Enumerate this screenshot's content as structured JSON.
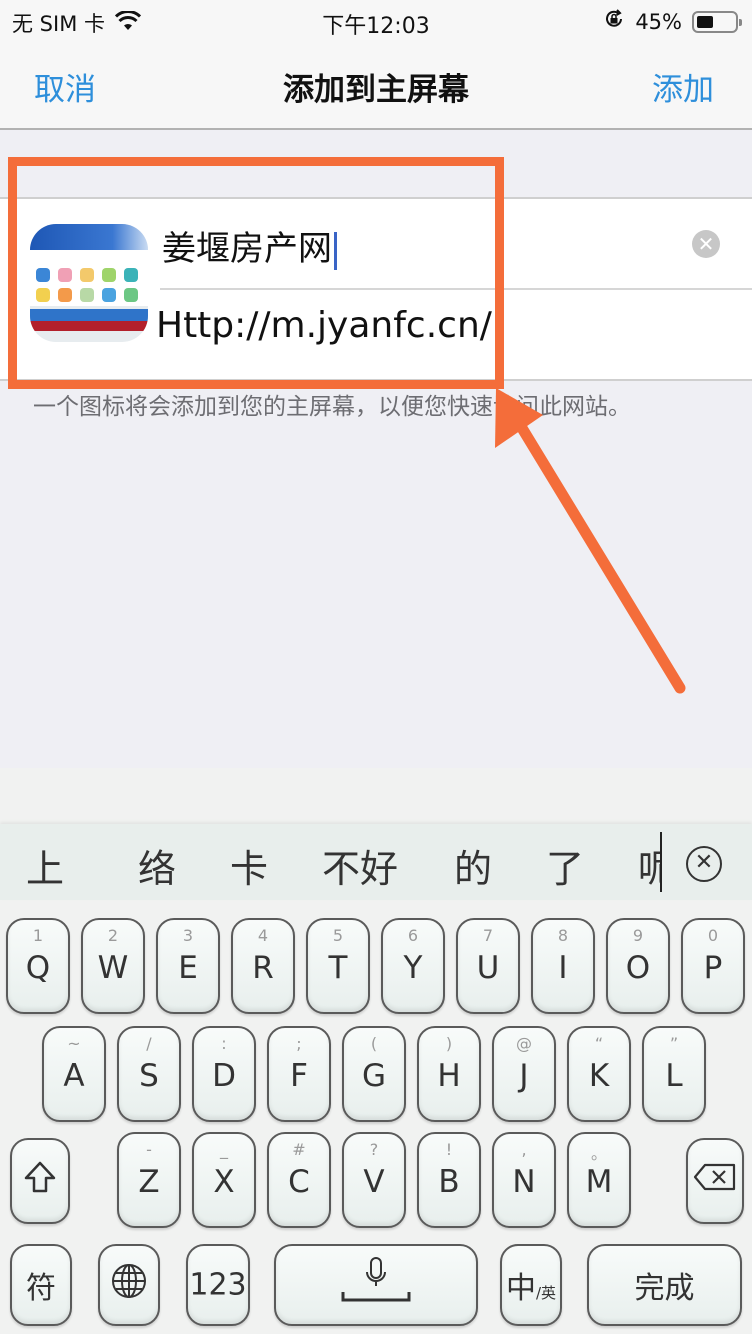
{
  "status_bar": {
    "carrier": "无 SIM 卡",
    "wifi_icon": "wifi-icon",
    "time": "下午12:03",
    "orientation_lock_icon": "orientation-lock-icon",
    "battery_percent_text": "45%",
    "battery_level": 0.45
  },
  "nav": {
    "cancel_label": "取消",
    "title": "添加到主屏幕",
    "add_label": "添加",
    "accent_color": "#2e8fdb"
  },
  "form": {
    "app_icon": "website-thumbnail-icon",
    "name_value": "姜堰房产网",
    "clear_icon": "clear-icon",
    "url_value": "Http://m.jyanfc.cn/"
  },
  "hint_text": "一个图标将会添加到您的主屏幕，以便您快速访问此网站。",
  "annotation": {
    "color": "#f46d3a"
  },
  "keyboard": {
    "candidates": [
      "上",
      "络",
      "卡",
      "不好",
      "的",
      "了",
      "呢"
    ],
    "row1": [
      {
        "main": "Q",
        "sub": "1"
      },
      {
        "main": "W",
        "sub": "2"
      },
      {
        "main": "E",
        "sub": "3"
      },
      {
        "main": "R",
        "sub": "4"
      },
      {
        "main": "T",
        "sub": "5"
      },
      {
        "main": "Y",
        "sub": "6"
      },
      {
        "main": "U",
        "sub": "7"
      },
      {
        "main": "I",
        "sub": "8"
      },
      {
        "main": "O",
        "sub": "9"
      },
      {
        "main": "P",
        "sub": "0"
      }
    ],
    "row2": [
      {
        "main": "A",
        "sub": "~"
      },
      {
        "main": "S",
        "sub": "/"
      },
      {
        "main": "D",
        "sub": ":"
      },
      {
        "main": "F",
        "sub": ";"
      },
      {
        "main": "G",
        "sub": "("
      },
      {
        "main": "H",
        "sub": ")"
      },
      {
        "main": "J",
        "sub": "@"
      },
      {
        "main": "K",
        "sub": "“"
      },
      {
        "main": "L",
        "sub": "”"
      }
    ],
    "row3": [
      {
        "main": "Z",
        "sub": "-"
      },
      {
        "main": "X",
        "sub": "_"
      },
      {
        "main": "C",
        "sub": "#"
      },
      {
        "main": "V",
        "sub": "?"
      },
      {
        "main": "B",
        "sub": "!"
      },
      {
        "main": "N",
        "sub": ","
      },
      {
        "main": "M",
        "sub": "。"
      }
    ],
    "shift_icon": "shift-icon",
    "delete_icon": "backspace-icon",
    "symbols_label": "符",
    "globe_icon": "globe-icon",
    "numbers_label": "123",
    "mic_icon": "microphone-icon",
    "lang_main": "中",
    "lang_sub": "/英",
    "done_label": "完成"
  }
}
